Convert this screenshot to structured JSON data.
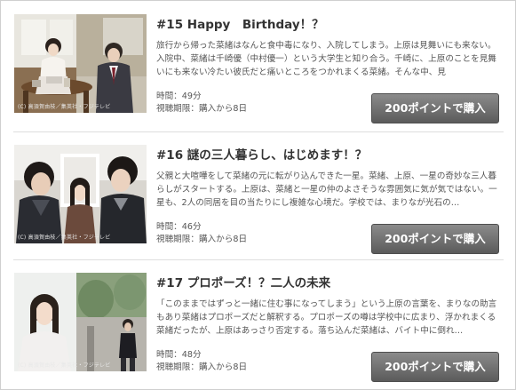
{
  "episodes": [
    {
      "title": "#15 Happy　Birthday！？",
      "synopsis": "旅行から帰った菜緒はなんと食中毒になり、入院してしまう。上原は見舞いにも来ない。入院中、菜緒は千崎優（中村優一）という大学生と知り合う。千崎に、上原のことを見舞いにも来ない冷たい彼氏だと痛いところをつかれまくる菜緒。そんな中、見",
      "duration": "時間：49分",
      "period": "視聴期限：購入から8日",
      "buy_label": "200ポイントで購入",
      "credit": "(C) 高須賀由枝／集英社・フジテレビ"
    },
    {
      "title": "#16 謎の三人暮らし、はじめます！？",
      "synopsis": "父親と大喧嘩をして菜緒の元に転がり込んできた一星。菜緒、上原、一星の奇妙な三人暮らしがスタートする。上原は、菜緒と一星の仲のよさそうな雰囲気に気が気ではない。一星も、2人の同居を目の当たりにし複雑な心境だ。学校では、まりなが光石の…",
      "duration": "時間：46分",
      "period": "視聴期限：購入から8日",
      "buy_label": "200ポイントで購入",
      "credit": "(C) 高須賀由枝／集英社・フジテレビ"
    },
    {
      "title": "#17 プロポーズ！？二人の未来",
      "synopsis": "「このままではずっと一緒に住む事になってしまう」という上原の言葉を、まりなの助言もあり菜緒はプロポーズだと解釈する。プロポーズの噂は学校中に広まり、浮かれまくる菜緒だったが、上原はあっさり否定する。落ち込んだ菜緒は、バイト中に倒れ…",
      "duration": "時間：48分",
      "period": "視聴期限：購入から8日",
      "buy_label": "200ポイントで購入",
      "credit": "(C) 高須賀由枝／集英社・フジテレビ"
    }
  ]
}
